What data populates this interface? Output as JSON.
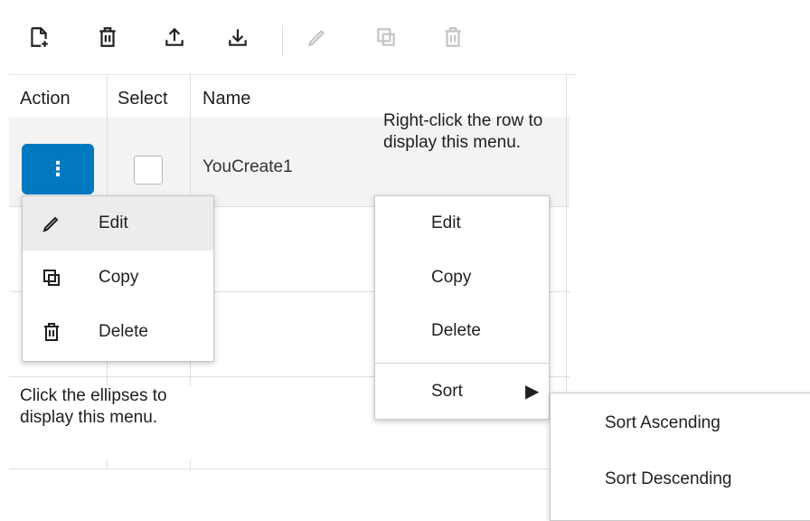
{
  "toolbar": {
    "buttons": [
      {
        "icon": "create-icon",
        "enabled": true
      },
      {
        "icon": "delete-all-icon",
        "enabled": true
      },
      {
        "icon": "upload-icon",
        "enabled": true
      },
      {
        "icon": "download-icon",
        "enabled": true
      },
      {
        "icon": "edit-icon",
        "enabled": false
      },
      {
        "icon": "copy-icon",
        "enabled": false
      },
      {
        "icon": "delete-icon",
        "enabled": false
      }
    ]
  },
  "table": {
    "columns": [
      "Action",
      "Select",
      "Name"
    ],
    "rows": [
      {
        "action": "⋮",
        "selected": false,
        "name": "YouCreate1"
      }
    ]
  },
  "notes": {
    "right_click": "Right-click the row to display this menu.",
    "ellipses": "Click the ellipses to display this menu."
  },
  "action_menu": {
    "items": [
      {
        "label": "Edit",
        "icon": "pencil-icon",
        "highlighted": true
      },
      {
        "label": "Copy",
        "icon": "copy-icon",
        "highlighted": false
      },
      {
        "label": "Delete",
        "icon": "trash-icon",
        "highlighted": false
      }
    ]
  },
  "context_menu": {
    "items": [
      {
        "label": "Edit"
      },
      {
        "label": "Copy"
      },
      {
        "label": "Delete"
      },
      {
        "label": "Sort",
        "submenu_arrow": "▶"
      }
    ]
  },
  "sort_submenu": {
    "items": [
      {
        "label": "Sort Ascending"
      },
      {
        "label": "Sort Descending"
      }
    ]
  },
  "colors": {
    "accent": "#0079c1",
    "highlight": "#ececec",
    "disabled": "#c4c4c4"
  }
}
